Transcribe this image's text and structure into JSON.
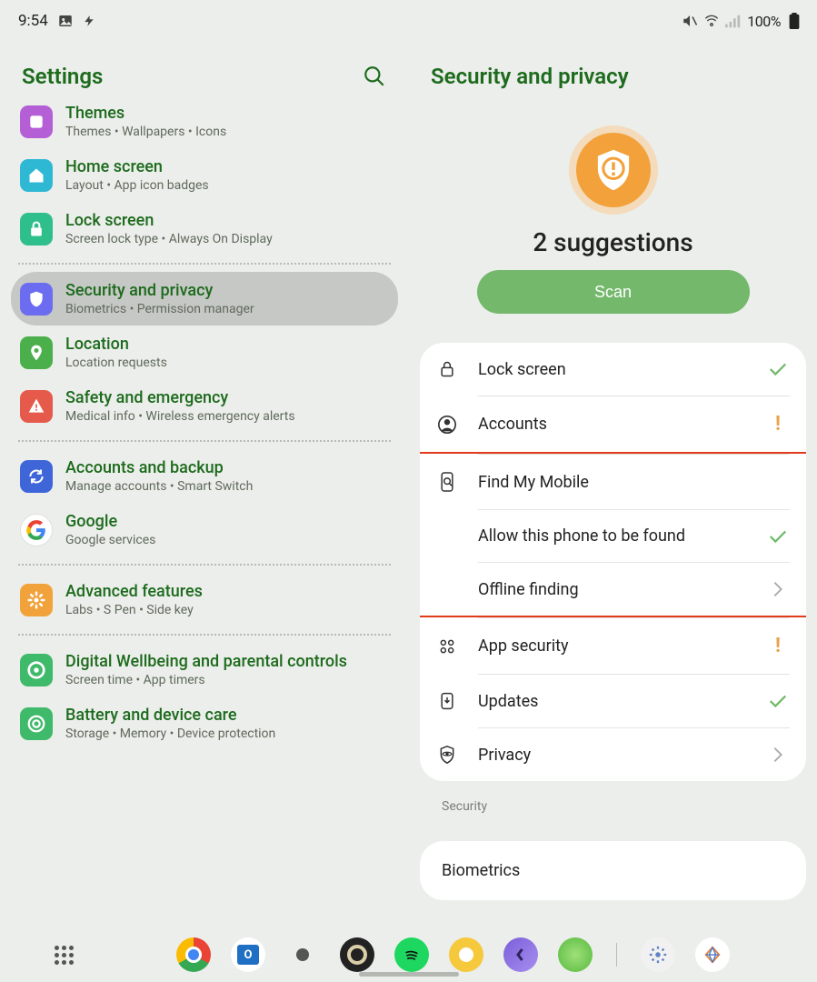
{
  "status": {
    "time": "9:54",
    "battery": "100%"
  },
  "left": {
    "title": "Settings",
    "items": [
      {
        "title": "Themes",
        "sub": "Themes  •  Wallpapers  •  Icons",
        "icon": "themes",
        "color": "#b45fd5"
      },
      {
        "title": "Home screen",
        "sub": "Layout  •  App icon badges",
        "icon": "home",
        "color": "#2fb8d4"
      },
      {
        "title": "Lock screen",
        "sub": "Screen lock type  •  Always On Display",
        "icon": "lock",
        "color": "#2fbf8b"
      },
      {
        "sep": true
      },
      {
        "title": "Security and privacy",
        "sub": "Biometrics  •  Permission manager",
        "icon": "shield",
        "color": "#6b6cf0",
        "selected": true
      },
      {
        "title": "Location",
        "sub": "Location requests",
        "icon": "pin",
        "color": "#4bb04b"
      },
      {
        "title": "Safety and emergency",
        "sub": "Medical info  •  Wireless emergency alerts",
        "icon": "alert",
        "color": "#e65a4b"
      },
      {
        "sep": true
      },
      {
        "title": "Accounts and backup",
        "sub": "Manage accounts  •  Smart Switch",
        "icon": "sync",
        "color": "#3f66d9"
      },
      {
        "title": "Google",
        "sub": "Google services",
        "icon": "google",
        "color": "#fff"
      },
      {
        "sep": true
      },
      {
        "title": "Advanced features",
        "sub": "Labs  •  S Pen  •  Side key",
        "icon": "gear",
        "color": "#f2a23b"
      },
      {
        "sep": true
      },
      {
        "title": "Digital Wellbeing and parental controls",
        "sub": "Screen time  •  App timers",
        "icon": "wellbeing",
        "color": "#3fb96a"
      },
      {
        "title": "Battery and device care",
        "sub": "Storage  •  Memory  •  Device protection",
        "icon": "care",
        "color": "#3fb96a"
      }
    ]
  },
  "right": {
    "title": "Security and privacy",
    "suggestions_label": "2 suggestions",
    "scan_label": "Scan",
    "rows": [
      {
        "label": "Lock screen",
        "icon": "lock",
        "trail": "check"
      },
      {
        "label": "Accounts",
        "icon": "person",
        "trail": "warn"
      },
      {
        "label": "Find My Mobile",
        "icon": "find",
        "trail": ""
      },
      {
        "label": "Allow this phone to be found",
        "sub": true,
        "trail": "check"
      },
      {
        "label": "Offline finding",
        "sub": true,
        "trail": "chev"
      },
      {
        "label": "App security",
        "icon": "apps",
        "trail": "warn"
      },
      {
        "label": "Updates",
        "icon": "update",
        "trail": "check"
      },
      {
        "label": "Privacy",
        "icon": "privacy",
        "trail": "chev"
      }
    ],
    "section_label": "Security",
    "biometrics_label": "Biometrics"
  }
}
